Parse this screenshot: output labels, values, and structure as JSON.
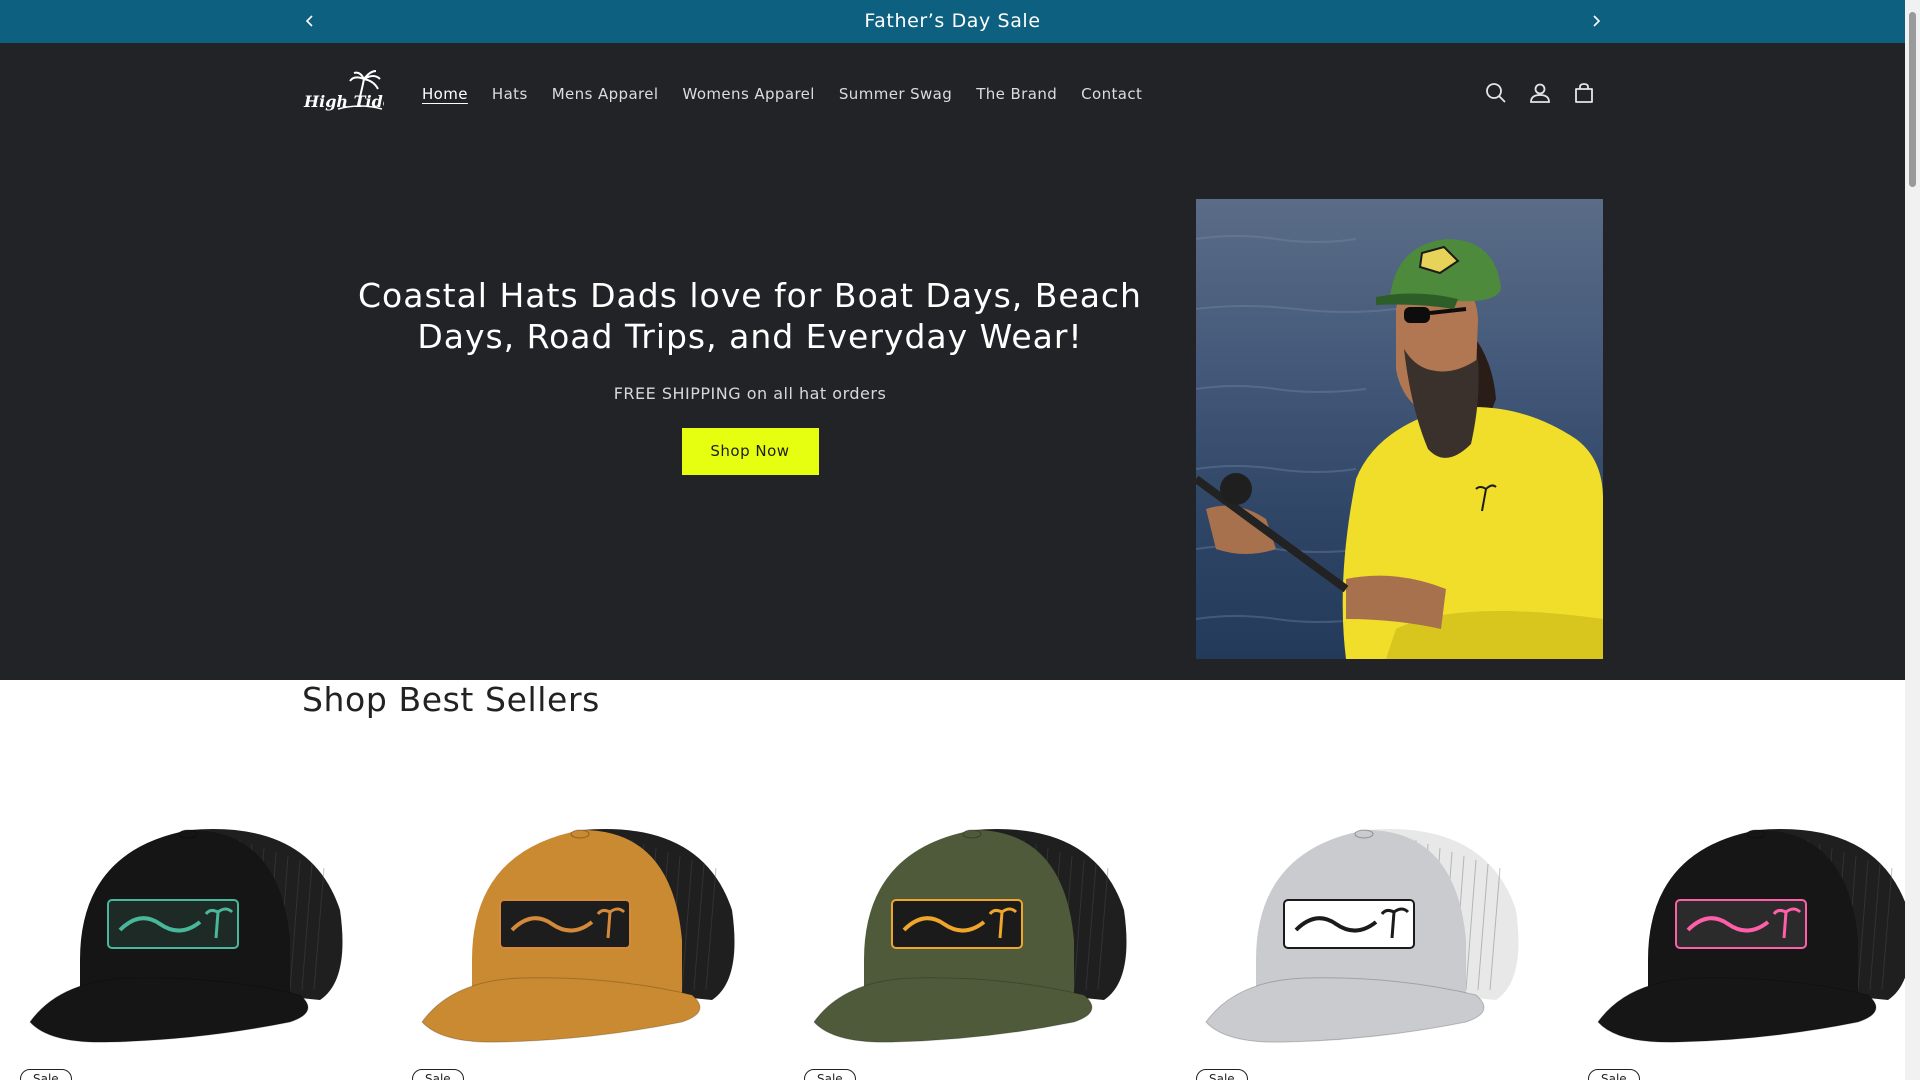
{
  "announcement": {
    "text": "Father’s Day Sale",
    "prev_icon": "chevron-left-icon",
    "next_icon": "chevron-right-icon"
  },
  "header": {
    "logo_text": "High Tide",
    "nav": [
      {
        "label": "Home",
        "active": true
      },
      {
        "label": "Hats",
        "active": false
      },
      {
        "label": "Mens Apparel",
        "active": false
      },
      {
        "label": "Womens Apparel",
        "active": false
      },
      {
        "label": "Summer Swag",
        "active": false
      },
      {
        "label": "The Brand",
        "active": false
      },
      {
        "label": "Contact",
        "active": false
      }
    ],
    "icons": [
      "search-icon",
      "account-icon",
      "cart-icon"
    ]
  },
  "hero": {
    "title": "Coastal Hats Dads love for Boat Days, Beach Days, Road Trips, and Everyday Wear!",
    "subtitle": "FREE SHIPPING on all hat orders",
    "button_label": "Shop Now"
  },
  "best_sellers": {
    "title": "Shop Best Sellers",
    "products": [
      {
        "badge": "Sale",
        "crown": "#151515",
        "mesh": "#1f1f1f",
        "patch": "#1e2a26",
        "patch_text": "#49b89a"
      },
      {
        "badge": "Sale",
        "crown": "#c98a32",
        "mesh": "#1f1f1f",
        "patch": "#1d1d1d",
        "patch_text": "#d58a3b"
      },
      {
        "badge": "Sale",
        "crown": "#4f5a3a",
        "mesh": "#1f1f1f",
        "patch": "#1b1b1b",
        "patch_text": "#f0a62a"
      },
      {
        "badge": "Sale",
        "crown": "#c9cbcf",
        "mesh": "#e8e8e8",
        "patch": "#ffffff",
        "patch_text": "#1b1b1b"
      },
      {
        "badge": "Sale",
        "crown": "#161616",
        "mesh": "#1f1f1f",
        "patch": "#2b2b2b",
        "patch_text": "#ff5fa8"
      }
    ]
  },
  "colors": {
    "announcement_bg": "#0d6080",
    "header_bg": "#222326",
    "button_bg": "#e6ff10"
  }
}
